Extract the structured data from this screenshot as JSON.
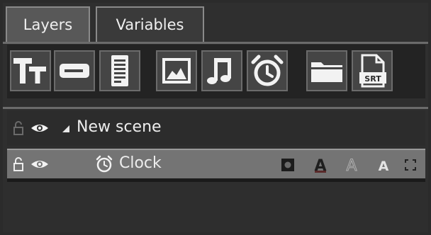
{
  "tabs": [
    {
      "label": "Layers",
      "active": true
    },
    {
      "label": "Variables",
      "active": false
    }
  ],
  "toolbar": {
    "tools": [
      {
        "name": "text-tool",
        "icon": "text-icon",
        "glyph": "TT"
      },
      {
        "name": "textbox-tool",
        "icon": "textbox-icon"
      },
      {
        "name": "document-tool",
        "icon": "document-icon"
      },
      {
        "name": "image-tool",
        "icon": "image-icon"
      },
      {
        "name": "audio-tool",
        "icon": "music-note-icon"
      },
      {
        "name": "clock-tool",
        "icon": "alarm-clock-icon"
      },
      {
        "name": "folder-tool",
        "icon": "folder-icon"
      },
      {
        "name": "subtitle-tool",
        "icon": "srt-file-icon",
        "glyph": "SRT"
      }
    ]
  },
  "layers": {
    "scene": {
      "label": "New scene",
      "expanded": true
    },
    "items": [
      {
        "label": "Clock",
        "icon": "alarm-clock-icon",
        "selected": true
      }
    ]
  },
  "colors": {
    "background": "#2b2b2b",
    "toolbar_bg": "#232323",
    "tool_bg": "#454545",
    "selected_row": "#747474",
    "text": "#ededed"
  }
}
